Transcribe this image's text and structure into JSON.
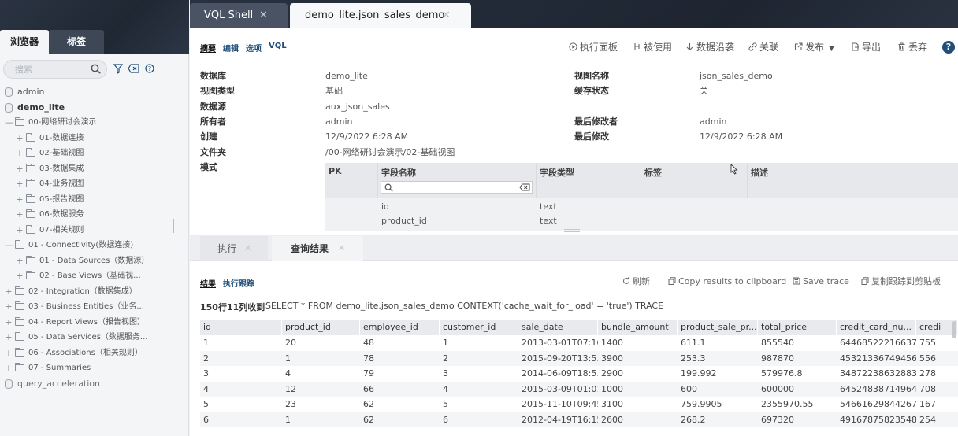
{
  "left_panel": {
    "tabs": [
      "浏览器",
      "标签"
    ],
    "search": {
      "placeholder": "搜索",
      "value": ""
    },
    "tree": [
      {
        "label": "admin",
        "level": 0,
        "type": "db",
        "expanded": false
      },
      {
        "label": "demo_lite",
        "level": 0,
        "type": "db",
        "expanded": true,
        "bold": true
      },
      {
        "label": "00-网络研讨会演示",
        "level": 1,
        "type": "folder",
        "expanded": true
      },
      {
        "label": "01-数据连接",
        "level": 2,
        "type": "folder",
        "expanded": false
      },
      {
        "label": "02-基础视图",
        "level": 2,
        "type": "folder",
        "expanded": false
      },
      {
        "label": "03-数据集成",
        "level": 2,
        "type": "folder",
        "expanded": false
      },
      {
        "label": "04-业务视图",
        "level": 2,
        "type": "folder",
        "expanded": false
      },
      {
        "label": "05-报告视图",
        "level": 2,
        "type": "folder",
        "expanded": false
      },
      {
        "label": "06-数据服务",
        "level": 2,
        "type": "folder",
        "expanded": false
      },
      {
        "label": "07-相关规则",
        "level": 2,
        "type": "folder",
        "expanded": false
      },
      {
        "label": "01 - Connectivity(数据连接)",
        "level": 1,
        "type": "folder",
        "expanded": true
      },
      {
        "label": "01 - Data Sources（数据源）",
        "level": 2,
        "type": "folder",
        "expanded": false
      },
      {
        "label": "02 - Base Views（基础视...",
        "level": 2,
        "type": "folder",
        "expanded": false
      },
      {
        "label": "02 - Integration（数据集成）",
        "level": 1,
        "type": "folder",
        "expanded": false
      },
      {
        "label": "03 - Business Entities（业务...",
        "level": 1,
        "type": "folder",
        "expanded": false
      },
      {
        "label": "04 - Report Views（报告视图）",
        "level": 1,
        "type": "folder",
        "expanded": false
      },
      {
        "label": "05 - Data Services（数据服务...",
        "level": 1,
        "type": "folder",
        "expanded": false
      },
      {
        "label": "06 - Associations（相关规则）",
        "level": 1,
        "type": "folder",
        "expanded": false
      },
      {
        "label": "07 - Summaries",
        "level": 1,
        "type": "folder",
        "expanded": false
      },
      {
        "label": "query_acceleration",
        "level": 0,
        "type": "db",
        "expanded": false,
        "muted": true
      }
    ]
  },
  "editor_tabs": [
    {
      "label": "VQL Shell",
      "active": false
    },
    {
      "label": "demo_lite.json_sales_demo",
      "active": true
    }
  ],
  "view": {
    "subtabs": [
      "摘要",
      "编辑",
      "选项",
      "VQL"
    ],
    "toolbar": [
      "执行面板",
      "被使用",
      "数据沿袭",
      "关联",
      "发布",
      "导出",
      "丢弃"
    ],
    "help": "?",
    "properties_left": [
      {
        "key": "数据库",
        "value": "demo_lite"
      },
      {
        "key": "视图类型",
        "value": "基础"
      },
      {
        "key": "数据源",
        "value": "aux_json_sales"
      },
      {
        "key": "所有者",
        "value": "admin"
      },
      {
        "key": "创建",
        "value": "12/9/2022 6:28 AM"
      },
      {
        "key": "文件夹",
        "value": "/00-网络研讨会演示/02-基础视图"
      },
      {
        "key": "模式",
        "value": ""
      }
    ],
    "properties_right": [
      {
        "key": "视图名称",
        "value": "json_sales_demo"
      },
      {
        "key": "缓存状态",
        "value": "关"
      },
      {
        "key": "最后修改者",
        "value": "admin"
      },
      {
        "key": "最后修改",
        "value": "12/9/2022 6:28 AM"
      }
    ],
    "schema": {
      "headers": [
        "PK",
        "字段名称",
        "字段类型",
        "标签",
        "描述"
      ],
      "rows": [
        {
          "name": "id",
          "type": "text"
        },
        {
          "name": "product_id",
          "type": "text"
        }
      ]
    }
  },
  "bottom": {
    "tabs": [
      "执行",
      "查询结果"
    ],
    "subtabs": [
      "结果",
      "执行跟踪"
    ],
    "toolbar": [
      "刷新",
      "Copy results to clipboard",
      "Save trace",
      "复制跟踪到剪贴板"
    ],
    "row_count": "150行11列收到",
    "query": "SELECT * FROM demo_lite.json_sales_demo CONTEXT('cache_wait_for_load' = 'true') TRACE",
    "columns": [
      "id",
      "product_id",
      "employee_id",
      "customer_id",
      "sale_date",
      "bundle_amount",
      "product_sale_pr...",
      "total_price",
      "credit_card_nu...",
      "credi"
    ],
    "rows": [
      [
        "1",
        "20",
        "48",
        "1",
        "2013-03-01T07:16...",
        "1400",
        "611.1",
        "855540",
        "64468522216637...",
        "755"
      ],
      [
        "2",
        "1",
        "78",
        "2",
        "2015-09-20T13:5...",
        "3900",
        "253.3",
        "987870",
        "45321336749456...",
        "556"
      ],
      [
        "3",
        "4",
        "79",
        "3",
        "2014-06-09T18:5...",
        "2900",
        "199.992",
        "579976.8",
        "348722386328838",
        "278"
      ],
      [
        "4",
        "12",
        "66",
        "4",
        "2015-03-09T01:01...",
        "1000",
        "600",
        "600000",
        "64524838714964...",
        "708"
      ],
      [
        "5",
        "23",
        "62",
        "5",
        "2015-11-10T09:45:...",
        "3100",
        "759.9905",
        "2355970.55",
        "54661629844267...",
        "167"
      ],
      [
        "6",
        "1",
        "62",
        "6",
        "2012-04-19T16:15:...",
        "2600",
        "268.2",
        "697320",
        "49167875823548...",
        "254"
      ]
    ]
  }
}
